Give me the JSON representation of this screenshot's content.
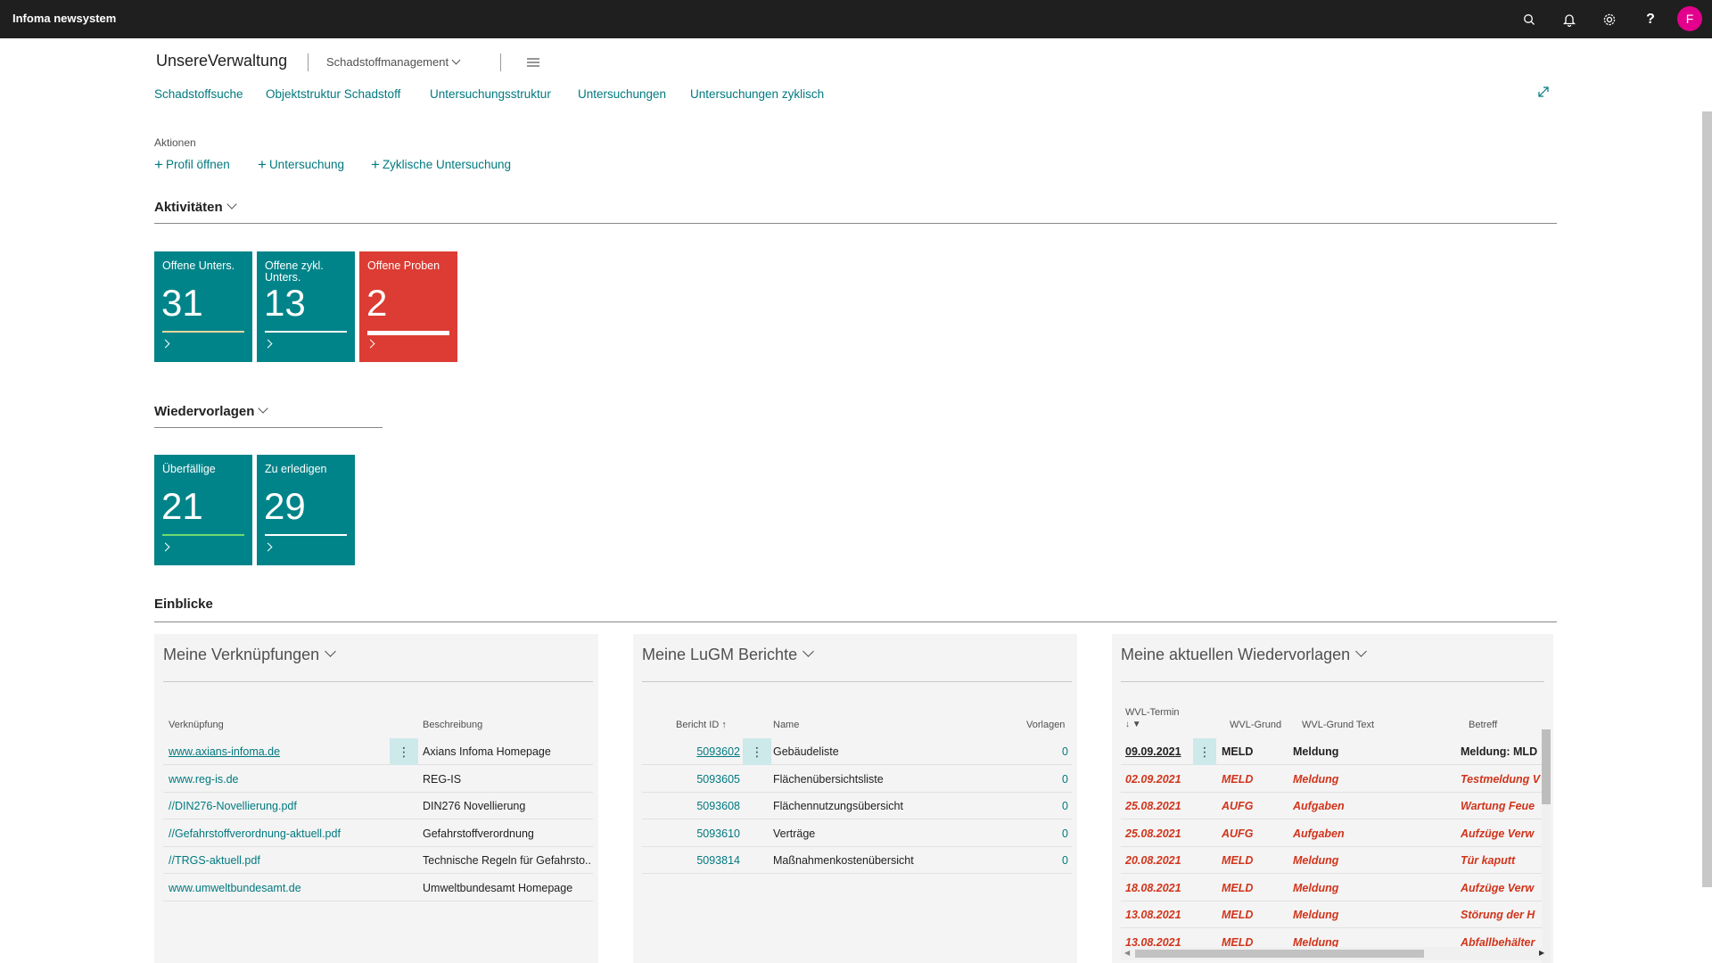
{
  "topbar": {
    "app_name": "Infoma newsystem",
    "avatar_letter": "F",
    "icons": [
      "search-icon",
      "bell-icon",
      "gear-icon",
      "help-icon"
    ],
    "help_glyph": "?",
    "avatar_color": "#e3008c"
  },
  "header": {
    "title": "UnsereVerwaltung",
    "module": "Schadstoffmanagement"
  },
  "nav": [
    "Schadstoffsuche",
    "Objektstruktur Schadstoff",
    "Untersuchungsstruktur",
    "Untersuchungen",
    "Untersuchungen zyklisch"
  ],
  "actions": {
    "label": "Aktionen",
    "items": [
      "Profil öffnen",
      "Untersuchung",
      "Zyklische Untersuchung"
    ]
  },
  "aktivitaeten": {
    "title": "Aktivitäten",
    "tiles": [
      {
        "title": "Offene Unters.",
        "value": "31",
        "color": "#008489",
        "bar_color": "#e6d7a0",
        "progress": 1.0
      },
      {
        "title": "Offene zykl. Unters.",
        "value": "13",
        "color": "#008489",
        "bar_color": "#ffffff",
        "progress": 1.0
      },
      {
        "title": "Offene Proben",
        "value": "2",
        "color": "#dc3c33",
        "bar_color": "#ffffff",
        "progress": 1.0
      }
    ]
  },
  "wiedervorlagen": {
    "title": "Wiedervorlagen",
    "tiles": [
      {
        "title": "Überfällige",
        "value": "21",
        "color": "#008489",
        "bar_color": "#6fdc6f",
        "progress": 1.0
      },
      {
        "title": "Zu erledigen",
        "value": "29",
        "color": "#008489",
        "bar_color": "#ffffff",
        "progress": 1.0
      }
    ]
  },
  "einblicke": {
    "title": "Einblicke",
    "verknuepfungen": {
      "title": "Meine Verknüpfungen",
      "columns": [
        "Verknüpfung",
        "Beschreibung"
      ],
      "rows": [
        {
          "link": "www.axians-infoma.de",
          "desc": "Axians Infoma Homepage"
        },
        {
          "link": "www.reg-is.de",
          "desc": "REG-IS"
        },
        {
          "link": "//DIN276-Novellierung.pdf",
          "desc": "DIN276 Novellierung"
        },
        {
          "link": "//Gefahrstoffverordnung-aktuell.pdf",
          "desc": "Gefahrstoffverordnung"
        },
        {
          "link": "//TRGS-aktuell.pdf",
          "desc": "Technische Regeln für Gefahrsto..."
        },
        {
          "link": "www.umweltbundesamt.de",
          "desc": "Umweltbundesamt Homepage"
        }
      ]
    },
    "berichte": {
      "title": "Meine LuGM Berichte",
      "columns": [
        "Bericht ID ↑",
        "Name",
        "Vorlagen"
      ],
      "rows": [
        {
          "id": "5093602",
          "name": "Gebäudeliste",
          "vorlagen": "0"
        },
        {
          "id": "5093605",
          "name": "Flächenübersichtsliste",
          "vorlagen": "0"
        },
        {
          "id": "5093608",
          "name": "Flächennutzungsübersicht",
          "vorlagen": "0"
        },
        {
          "id": "5093610",
          "name": "Verträge",
          "vorlagen": "0"
        },
        {
          "id": "5093814",
          "name": "Maßnahmenkostenübersicht",
          "vorlagen": "0"
        }
      ]
    },
    "aktuelle_wv": {
      "title": "Meine aktuellen Wiedervorlagen",
      "columns": [
        "WVL-Termin",
        "WVL-Grund",
        "WVL-Grund Text",
        "Betreff"
      ],
      "rows": [
        {
          "termin": "09.09.2021",
          "grund": "MELD",
          "text": "Meldung",
          "betreff": "Meldung: MLD",
          "style": "bold"
        },
        {
          "termin": "02.09.2021",
          "grund": "MELD",
          "text": "Meldung",
          "betreff": "Testmeldung V",
          "style": "red"
        },
        {
          "termin": "25.08.2021",
          "grund": "AUFG",
          "text": "Aufgaben",
          "betreff": "Wartung Feue",
          "style": "red"
        },
        {
          "termin": "25.08.2021",
          "grund": "AUFG",
          "text": "Aufgaben",
          "betreff": "Aufzüge Verw",
          "style": "red"
        },
        {
          "termin": "20.08.2021",
          "grund": "MELD",
          "text": "Meldung",
          "betreff": "Tür kaputt",
          "style": "red"
        },
        {
          "termin": "18.08.2021",
          "grund": "MELD",
          "text": "Meldung",
          "betreff": "Aufzüge Verw",
          "style": "red"
        },
        {
          "termin": "13.08.2021",
          "grund": "MELD",
          "text": "Meldung",
          "betreff": "Störung der H",
          "style": "red"
        },
        {
          "termin": "13.08.2021",
          "grund": "MELD",
          "text": "Meldung",
          "betreff": "Abfallbehälter",
          "style": "red"
        }
      ]
    }
  }
}
